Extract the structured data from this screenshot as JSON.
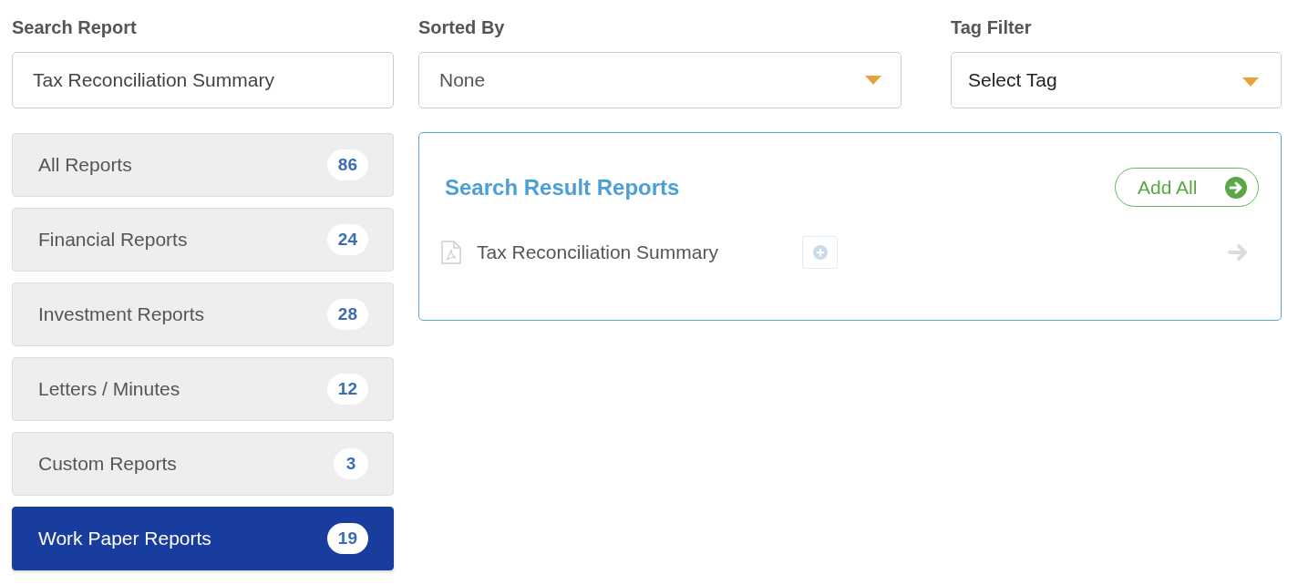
{
  "search": {
    "label": "Search Report",
    "value": "Tax Reconciliation Summary"
  },
  "sort": {
    "label": "Sorted By",
    "value": "None"
  },
  "tag_filter": {
    "label": "Tag Filter",
    "value": "Select Tag"
  },
  "categories": [
    {
      "label": "All Reports",
      "count": "86",
      "selected": false
    },
    {
      "label": "Financial Reports",
      "count": "24",
      "selected": false
    },
    {
      "label": "Investment Reports",
      "count": "28",
      "selected": false
    },
    {
      "label": "Letters / Minutes",
      "count": "12",
      "selected": false
    },
    {
      "label": "Custom Reports",
      "count": "3",
      "selected": false
    },
    {
      "label": "Work Paper Reports",
      "count": "19",
      "selected": true
    }
  ],
  "results": {
    "title": "Search Result Reports",
    "add_all": "Add All",
    "items": [
      {
        "name": "Tax Reconciliation Summary"
      }
    ]
  }
}
